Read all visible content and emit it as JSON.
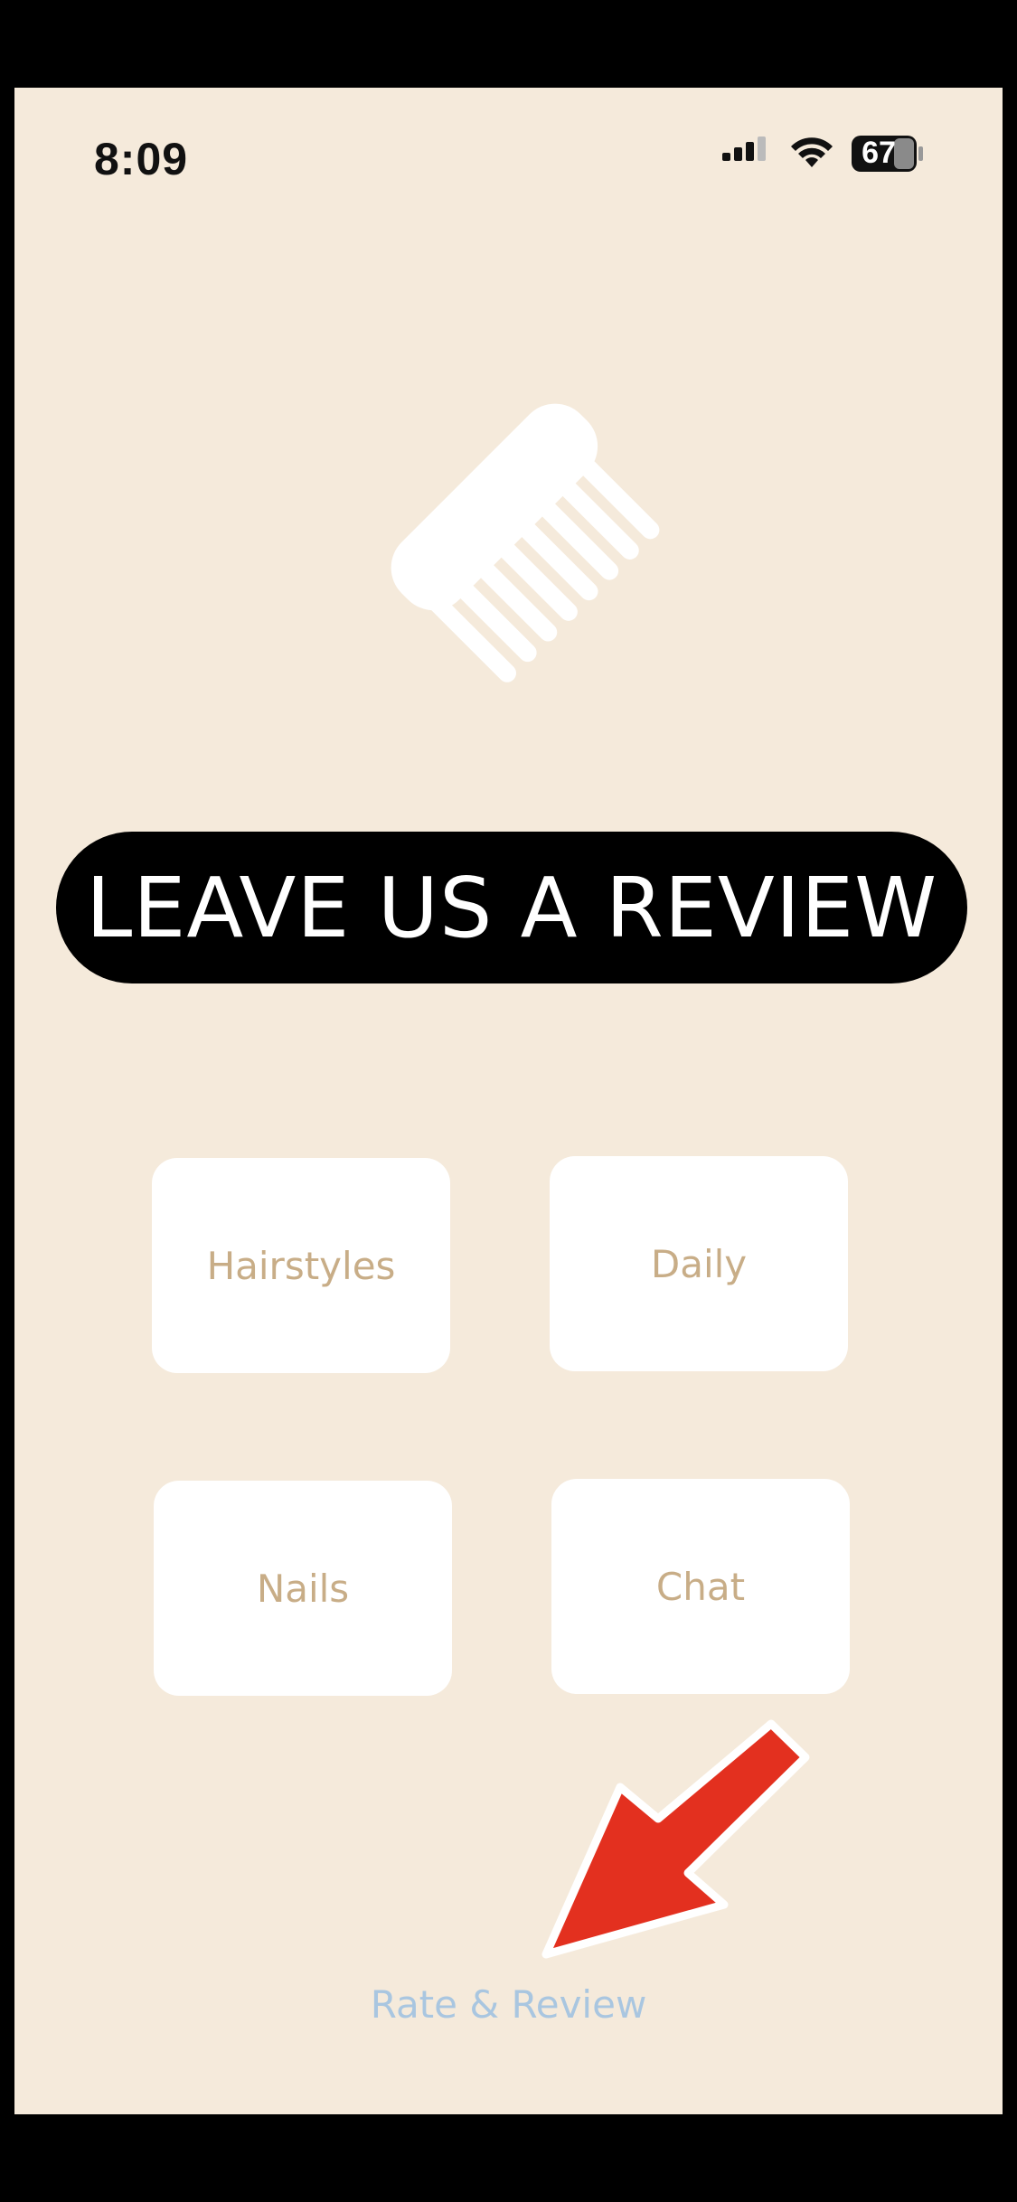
{
  "status_bar": {
    "time": "8:09",
    "battery": "67",
    "icons": [
      "signal-icon",
      "wifi-icon",
      "battery-icon"
    ]
  },
  "logo": {
    "icon": "comb-icon",
    "color": "#ffffff"
  },
  "banner": {
    "text": "LEAVE US A REVIEW"
  },
  "menu": {
    "items": [
      {
        "label": "Hairstyles"
      },
      {
        "label": "Daily"
      },
      {
        "label": "Nails"
      },
      {
        "label": "Chat"
      }
    ]
  },
  "annotation": {
    "icon": "arrow-icon",
    "color": "#e3301f"
  },
  "footer": {
    "rate_label": "Rate & Review",
    "link_color": "#a9c6e0"
  },
  "colors": {
    "background": "#f5eadb",
    "tile": "#ffffff",
    "tile_text": "#c8ad87",
    "banner": "#000000"
  }
}
